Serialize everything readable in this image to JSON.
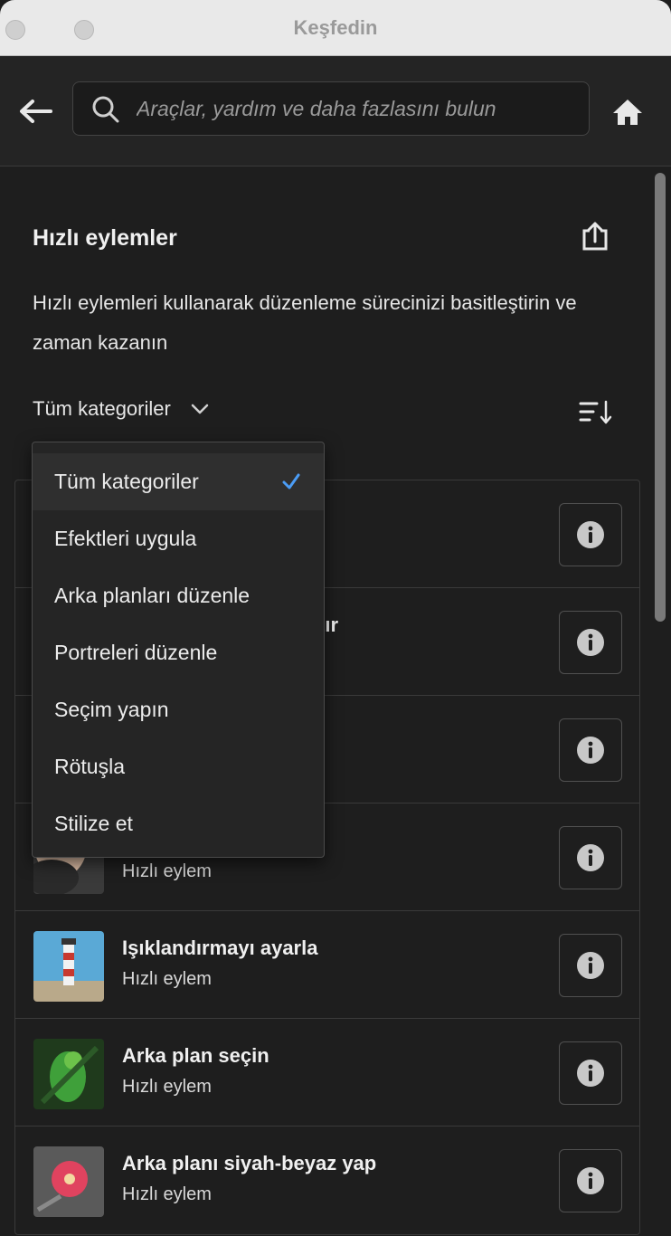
{
  "window": {
    "title": "Keşfedin"
  },
  "search": {
    "placeholder": "Araçlar, yardım ve daha fazlasını bulun"
  },
  "section": {
    "title": "Hızlı eylemler",
    "description": "Hızlı eylemleri kullanarak düzenleme sürecinizi basitleştirin ve zaman kazanın",
    "category_label": "Tüm kategoriler"
  },
  "dropdown": {
    "options": [
      {
        "label": "Tüm kategoriler",
        "selected": true
      },
      {
        "label": "Efektleri uygula",
        "selected": false
      },
      {
        "label": "Arka planları düzenle",
        "selected": false
      },
      {
        "label": "Portreleri düzenle",
        "selected": false
      },
      {
        "label": "Seçim yapın",
        "selected": false
      },
      {
        "label": "Rötuşla",
        "selected": false
      },
      {
        "label": "Stilize et",
        "selected": false
      }
    ]
  },
  "actions": [
    {
      "title": "",
      "subtitle": "",
      "thumb_icon": "hidden-thumbnail"
    },
    {
      "title": "tır",
      "subtitle": "",
      "thumb_icon": "hidden-thumbnail"
    },
    {
      "title": "",
      "subtitle": "",
      "thumb_icon": "hidden-thumbnail"
    },
    {
      "title": "",
      "subtitle": "Hızlı eylem",
      "thumb_icon": "portrait-photo"
    },
    {
      "title": "Işıklandırmayı ayarla",
      "subtitle": "Hızlı eylem",
      "thumb_icon": "lighthouse-photo"
    },
    {
      "title": "Arka plan seçin",
      "subtitle": "Hızlı eylem",
      "thumb_icon": "parrot-photo"
    },
    {
      "title": "Arka planı siyah-beyaz yap",
      "subtitle": "Hızlı eylem",
      "thumb_icon": "flower-photo"
    }
  ],
  "colors": {
    "accent": "#4b9cf5",
    "background": "#1e1e1e",
    "titlebar": "#e9e9e9"
  }
}
